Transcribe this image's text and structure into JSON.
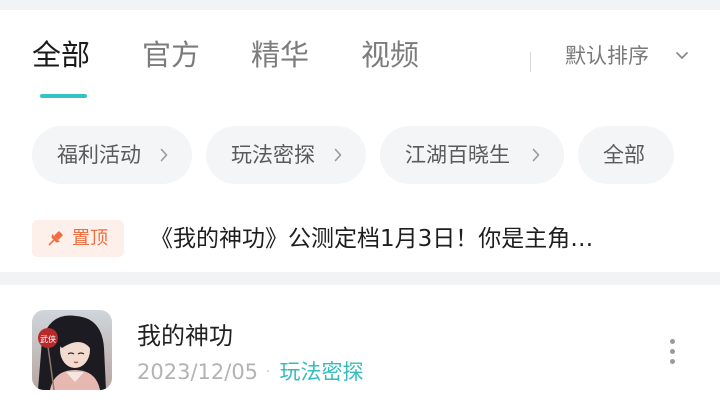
{
  "tabs": [
    {
      "label": "全部",
      "active": true
    },
    {
      "label": "官方",
      "active": false
    },
    {
      "label": "精华",
      "active": false
    },
    {
      "label": "视频",
      "active": false
    }
  ],
  "sort": {
    "label": "默认排序",
    "icon": "chevron-down-icon"
  },
  "chips": [
    {
      "label": "福利活动",
      "has_arrow": true
    },
    {
      "label": "玩法密探",
      "has_arrow": true
    },
    {
      "label": "江湖百晓生",
      "has_arrow": true
    },
    {
      "label": "全部",
      "has_arrow": false
    }
  ],
  "pinned": {
    "badge": "置顶",
    "badge_icon": "pin-icon",
    "title": "《我的神功》公测定档1月3日！你是主角…"
  },
  "post": {
    "author": "我的神功",
    "date": "2023/12/05",
    "separator": "·",
    "category": "玩法密探",
    "avatar_badge": "武侠",
    "more_icon": "more-vertical-icon"
  },
  "colors": {
    "accent": "#35c2c2",
    "pin": "#f06d3f",
    "pin_bg": "#fdf0ea",
    "chip_bg": "#f4f5f7"
  }
}
